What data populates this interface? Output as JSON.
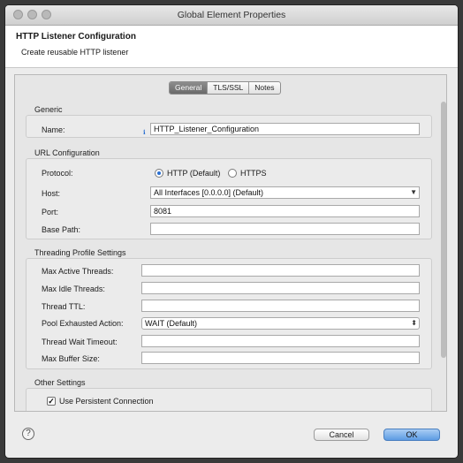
{
  "window": {
    "title": "Global Element Properties"
  },
  "header": {
    "title": "HTTP Listener Configuration",
    "subtitle": "Create reusable HTTP listener"
  },
  "tabs": [
    {
      "label": "General",
      "active": true
    },
    {
      "label": "TLS/SSL",
      "active": false
    },
    {
      "label": "Notes",
      "active": false
    }
  ],
  "generic": {
    "section_label": "Generic",
    "name_label": "Name:",
    "name_value": "HTTP_Listener_Configuration"
  },
  "url_config": {
    "section_label": "URL Configuration",
    "protocol_label": "Protocol:",
    "protocol_http": "HTTP (Default)",
    "protocol_https": "HTTPS",
    "protocol_selected": "HTTP (Default)",
    "host_label": "Host:",
    "host_value": "All Interfaces [0.0.0.0] (Default)",
    "port_label": "Port:",
    "port_value": "8081",
    "base_path_label": "Base Path:",
    "base_path_value": ""
  },
  "threading": {
    "section_label": "Threading Profile Settings",
    "max_active_label": "Max Active Threads:",
    "max_idle_label": "Max Idle Threads:",
    "thread_ttl_label": "Thread TTL:",
    "pool_exhausted_label": "Pool Exhausted Action:",
    "pool_exhausted_value": "WAIT (Default)",
    "thread_wait_label": "Thread Wait Timeout:",
    "max_buffer_label": "Max Buffer Size:"
  },
  "other": {
    "section_label": "Other Settings",
    "persistent_label": "Use Persistent Connection",
    "persistent_checked": true
  },
  "buttons": {
    "cancel": "Cancel",
    "ok": "OK",
    "help": "?"
  }
}
